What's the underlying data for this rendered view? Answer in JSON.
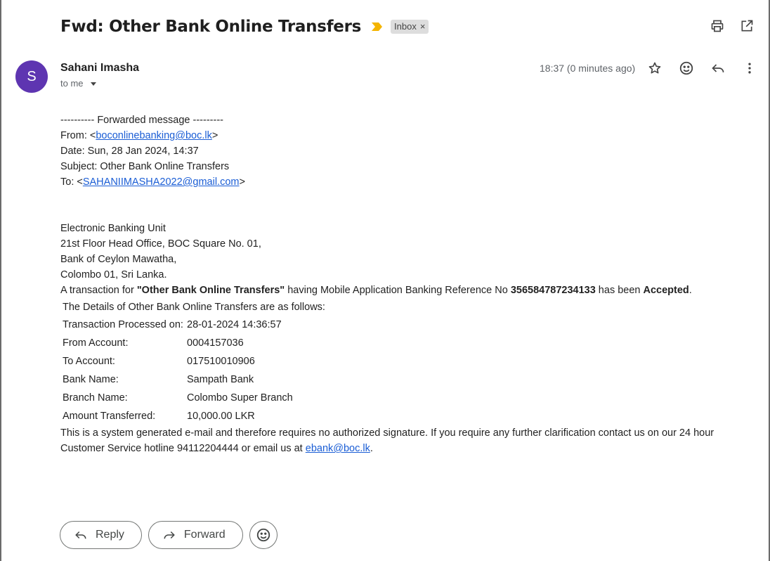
{
  "header": {
    "subject": "Fwd: Other Bank Online Transfers",
    "label": "Inbox",
    "label_close": "×",
    "important_color": "#f4b400"
  },
  "toolbar": {
    "print_icon": "print-icon",
    "open_new_window_icon": "open-in-new-icon"
  },
  "message": {
    "avatar_letter": "S",
    "avatar_color": "#5e35b1",
    "sender_name": "Sahani Imasha",
    "recipient": "to me",
    "time": "18:37 (0 minutes ago)"
  },
  "forward": {
    "separator": "---------- Forwarded message ---------",
    "from_prefix": "From: <",
    "from_email": "boconlinebanking@boc.lk",
    "from_suffix": ">",
    "date": "Date: Sun, 28 Jan 2024, 14:37",
    "subject": "Subject: Other Bank Online Transfers",
    "to_prefix": "To: <",
    "to_email": "SAHANIIMASHA2022@gmail.com",
    "to_suffix": ">"
  },
  "address": {
    "line1": "Electronic Banking Unit",
    "line2": "21st Floor Head Office, BOC Square No. 01,",
    "line3": "Bank of Ceylon Mawatha,",
    "line4": "Colombo 01, Sri Lanka."
  },
  "notice": {
    "pre": "A transaction for ",
    "type": "\"Other Bank Online Transfers\"",
    "mid": " having Mobile Application Banking Reference No ",
    "ref": "356584787234133",
    "mid2": " has been ",
    "status": "Accepted",
    "end": "."
  },
  "details": {
    "intro": "The Details of Other Bank Online Transfers are as follows:",
    "rows": [
      {
        "label": "Transaction Processed on:",
        "value": "28-01-2024 14:36:57"
      },
      {
        "label": "From Account:",
        "value": "0004157036"
      },
      {
        "label": "To Account:",
        "value": "017510010906"
      },
      {
        "label": "Bank Name:",
        "value": "Sampath Bank"
      },
      {
        "label": "Branch Name:",
        "value": "Colombo Super Branch"
      },
      {
        "label": "Amount Transferred:",
        "value": "10,000.00 LKR"
      }
    ]
  },
  "footer": {
    "line1": "This is a system generated e-mail and therefore requires no authorized signature. If you require any further clarification contact us on our 24 hour",
    "line2_pre": "Customer Service hotline 94112204444 or email us at ",
    "email": "ebank@boc.lk",
    "line2_end": "."
  },
  "actions": {
    "reply": "Reply",
    "forward": "Forward"
  }
}
